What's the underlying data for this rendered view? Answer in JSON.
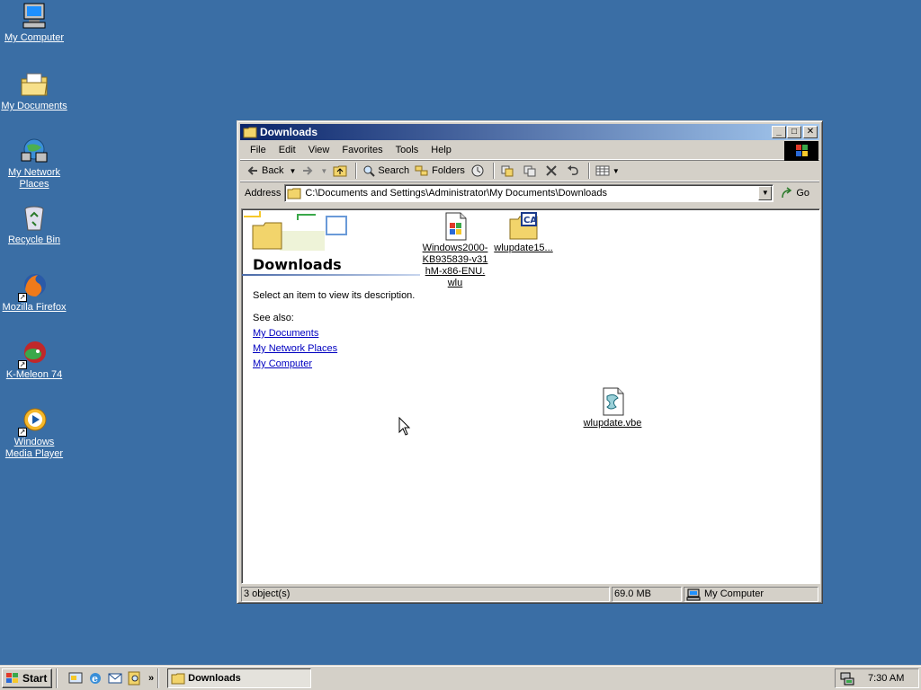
{
  "desktop": {
    "icons": [
      {
        "label": "My Computer",
        "icon": "computer-icon"
      },
      {
        "label": "My Documents",
        "icon": "documents-folder-icon"
      },
      {
        "label": "My Network Places",
        "icon": "network-places-icon"
      },
      {
        "label": "Recycle Bin",
        "icon": "recycle-bin-icon"
      },
      {
        "label": "Mozilla Firefox",
        "icon": "firefox-icon"
      },
      {
        "label": "K-Meleon 74",
        "icon": "kmeleon-icon"
      },
      {
        "label": "Windows Media Player",
        "icon": "media-player-icon"
      }
    ]
  },
  "window": {
    "title": "Downloads",
    "menu": [
      "File",
      "Edit",
      "View",
      "Favorites",
      "Tools",
      "Help"
    ],
    "toolbar": {
      "back": "Back",
      "search": "Search",
      "folders": "Folders"
    },
    "address": {
      "label": "Address",
      "value": "C:\\Documents and Settings\\Administrator\\My Documents\\Downloads",
      "go": "Go"
    },
    "pane": {
      "title": "Downloads",
      "description": "Select an item to view its description.",
      "see_also": "See also:",
      "links": [
        "My Documents",
        "My Network Places",
        "My Computer"
      ]
    },
    "files": [
      {
        "label": "Windows2000-KB935839-v31hM-x86-ENU.wlu",
        "line1": "Windows2000-",
        "line2": "KB935839-v31",
        "line3": "hM-x86-ENU.",
        "line4": "wlu",
        "icon": "windows-update-file-icon"
      },
      {
        "label": "wlupdate15...",
        "icon": "cab-archive-icon"
      },
      {
        "label": "wlupdate.vbe",
        "icon": "script-file-icon"
      }
    ],
    "status": {
      "objects": "3 object(s)",
      "size": "69.0 MB",
      "zone": "My Computer"
    }
  },
  "taskbar": {
    "start": "Start",
    "task": "Downloads",
    "clock": "7:30 AM"
  }
}
